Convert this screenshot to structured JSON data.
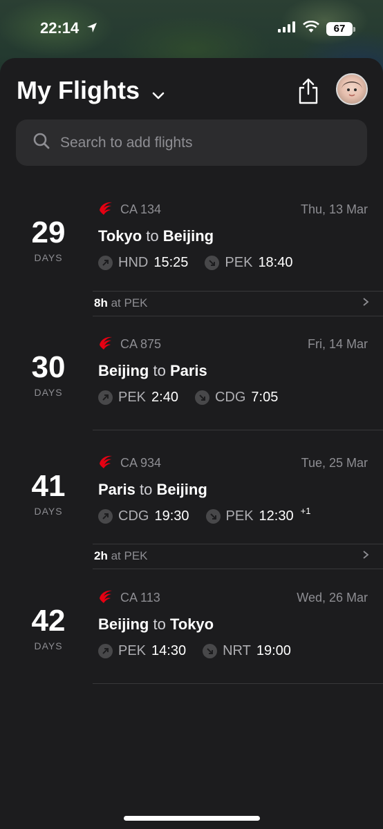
{
  "status": {
    "time": "22:14",
    "battery": "67"
  },
  "header": {
    "title": "My Flights"
  },
  "search": {
    "placeholder": "Search to add flights"
  },
  "flights": [
    {
      "days": "29",
      "days_label": "DAYS",
      "flight_no": "CA 134",
      "date": "Thu, 13 Mar",
      "origin": "Tokyo",
      "to": "to",
      "destination": "Beijing",
      "dep_code": "HND",
      "dep_time": "15:25",
      "arr_code": "PEK",
      "arr_time": "18:40",
      "arr_offset": ""
    },
    {
      "days": "30",
      "days_label": "DAYS",
      "flight_no": "CA 875",
      "date": "Fri, 14 Mar",
      "origin": "Beijing",
      "to": "to",
      "destination": "Paris",
      "dep_code": "PEK",
      "dep_time": "2:40",
      "arr_code": "CDG",
      "arr_time": "7:05",
      "arr_offset": ""
    },
    {
      "days": "41",
      "days_label": "DAYS",
      "flight_no": "CA 934",
      "date": "Tue, 25 Mar",
      "origin": "Paris",
      "to": "to",
      "destination": "Beijing",
      "dep_code": "CDG",
      "dep_time": "19:30",
      "arr_code": "PEK",
      "arr_time": "12:30",
      "arr_offset": "+1"
    },
    {
      "days": "42",
      "days_label": "DAYS",
      "flight_no": "CA 113",
      "date": "Wed, 26 Mar",
      "origin": "Beijing",
      "to": "to",
      "destination": "Tokyo",
      "dep_code": "PEK",
      "dep_time": "14:30",
      "arr_code": "NRT",
      "arr_time": "19:00",
      "arr_offset": ""
    }
  ],
  "layovers": [
    {
      "duration": "8h",
      "at": "at PEK"
    },
    {
      "duration": "2h",
      "at": "at PEK"
    }
  ],
  "colors": {
    "airline_red": "#e60012",
    "background": "#1c1c1e",
    "search_bg": "#2c2c2e"
  },
  "icons": [
    "location-arrow-icon",
    "signal-icon",
    "wifi-icon",
    "chevron-down-icon",
    "share-icon",
    "search-icon",
    "air-china-logo-icon",
    "takeoff-arrow-icon",
    "landing-arrow-icon",
    "chevron-right-icon"
  ]
}
